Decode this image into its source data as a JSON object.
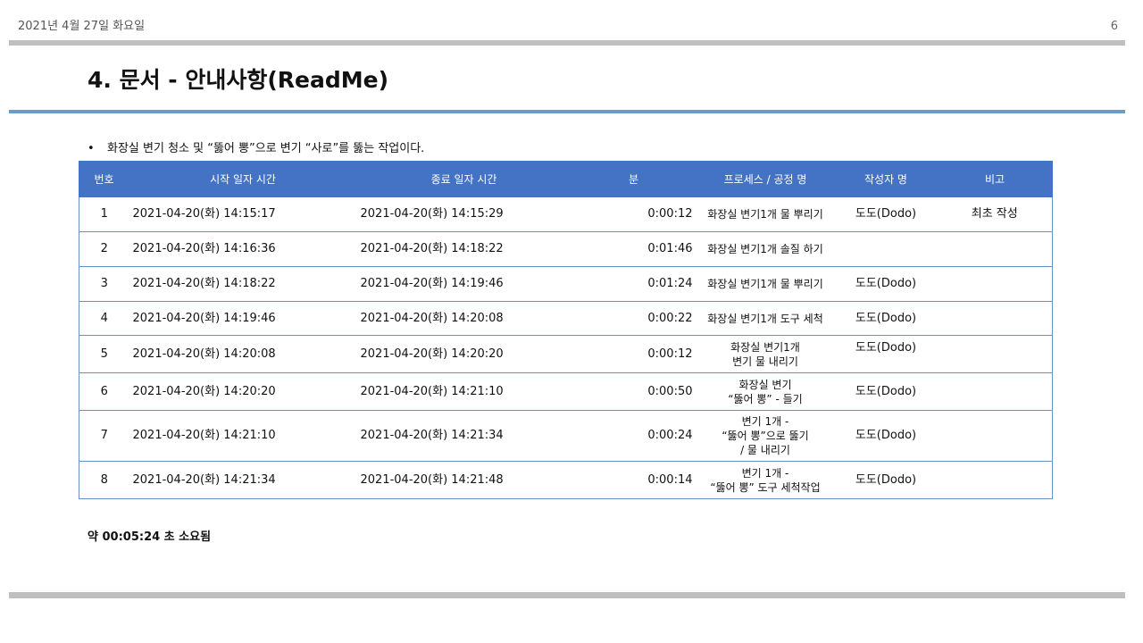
{
  "header": {
    "date": "2021년 4월 27일 화요일",
    "page_number": "6"
  },
  "title": "4. 문서 - 안내사항(ReadMe)",
  "bullet": {
    "marker": "•",
    "text": "화장실 변기 청소 및 “뚫어 뽕”으로 변기 “사로”를 뚫는 작업이다."
  },
  "table": {
    "headers": [
      "번호",
      "시작 일자 시간",
      "종료 일자 시간",
      "분",
      "프로세스 / 공정 명",
      "작성자 명",
      "비고"
    ],
    "rows": [
      {
        "no": "1",
        "start": "2021-04-20(화) 14:15:17",
        "end": "2021-04-20(화) 14:15:29",
        "min": "0:00:12",
        "process": "화장실 변기1개 물 뿌리기",
        "author": "도도(Dodo)",
        "note": "최초 작성"
      },
      {
        "no": "2",
        "start": "2021-04-20(화) 14:16:36",
        "end": "2021-04-20(화) 14:18:22",
        "min": "0:01:46",
        "process": "화장실 변기1개 솔질 하기",
        "author": "",
        "note": ""
      },
      {
        "no": "3",
        "start": "2021-04-20(화) 14:18:22",
        "end": "2021-04-20(화) 14:19:46",
        "min": "0:01:24",
        "process": "화장실 변기1개 물 뿌리기",
        "author": "도도(Dodo)",
        "note": ""
      },
      {
        "no": "4",
        "start": "2021-04-20(화) 14:19:46",
        "end": "2021-04-20(화) 14:20:08",
        "min": "0:00:22",
        "process": "화장실 변기1개 도구 세척",
        "author": "도도(Dodo)",
        "note": ""
      },
      {
        "no": "5",
        "start": "2021-04-20(화) 14:20:08",
        "end": "2021-04-20(화) 14:20:20",
        "min": "0:00:12",
        "process": "화장실 변기1개\n변기 물 내리기",
        "author": "도도(Dodo)",
        "note": ""
      },
      {
        "no": "6",
        "start": "2021-04-20(화) 14:20:20",
        "end": "2021-04-20(화) 14:21:10",
        "min": "0:00:50",
        "process": "화장실 변기\n“뚫어 뽕” - 들기",
        "author": "도도(Dodo)",
        "note": ""
      },
      {
        "no": "7",
        "start": "2021-04-20(화) 14:21:10",
        "end": "2021-04-20(화) 14:21:34",
        "min": "0:00:24",
        "process": "변기 1개 -\n“뚫어 뽕”으로 뚫기\n/ 물 내리기",
        "author": "도도(Dodo)",
        "note": ""
      },
      {
        "no": "8",
        "start": "2021-04-20(화) 14:21:34",
        "end": "2021-04-20(화) 14:21:48",
        "min": "0:00:14",
        "process": "변기 1개 -\n“뚫어 뽕” 도구 세척작업",
        "author": "도도(Dodo)",
        "note": ""
      }
    ]
  },
  "summary": "약 00:05:24 초 소요됨",
  "colors": {
    "header_bg": "#4472c4",
    "accent_line": "#6d9bc7",
    "gray_bar": "#bfbfbf"
  }
}
